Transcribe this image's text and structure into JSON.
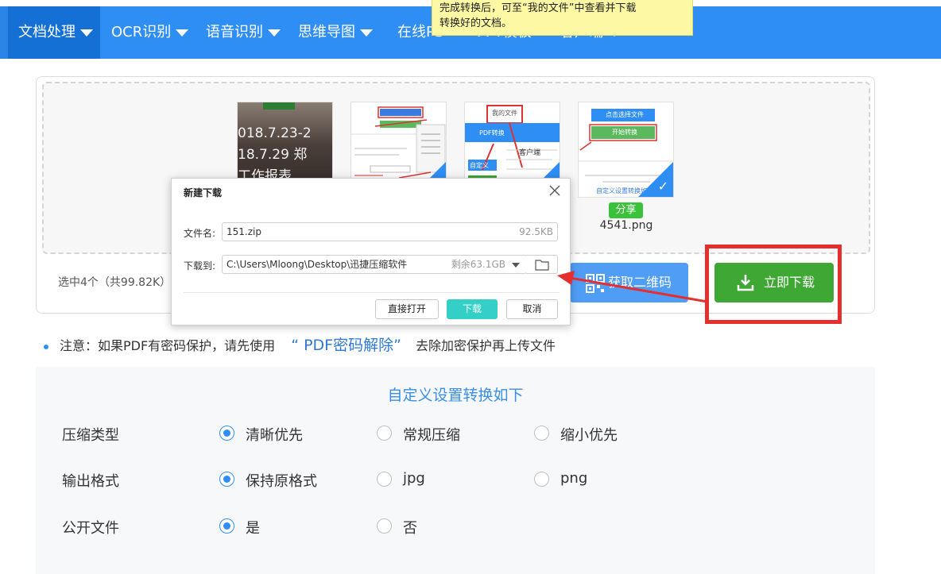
{
  "nav": {
    "items": [
      {
        "label": "文档处理",
        "dropdown": true
      },
      {
        "label": "OCR识别",
        "dropdown": true
      },
      {
        "label": "语音识别",
        "dropdown": true
      },
      {
        "label": "思维导图",
        "dropdown": true
      },
      {
        "label": "在线PS",
        "dropdown": false
      },
      {
        "label": "PPT模板",
        "dropdown": false
      },
      {
        "label": "客户端",
        "dropdown": true
      }
    ],
    "active_index": 0,
    "colors": {
      "bar": "#2f8ef4",
      "active": "#1570d6"
    }
  },
  "tooltip": {
    "line1": "完成转换后，可至“我的文件”中查看并下载",
    "line2": "转换好的文档。"
  },
  "upload": {
    "thumb1_lines": [
      "018.7.23-2",
      "18.7.29 郑",
      "工作报表"
    ],
    "thumb4": {
      "share_label": "分享",
      "file_name": "4541.png",
      "top_button": "点击选择文件",
      "mid_button": "开始转换",
      "bottom_link": "自定义设置转换如下"
    },
    "thumb3": {
      "tab_label": "我的文件",
      "blue_tab": "PDF转换",
      "customer": "客户端",
      "side": "自定义"
    },
    "selected_info": "选中4个（共99.82K）",
    "qr_button": "获取二维码",
    "download_button": "立即下载"
  },
  "dialog": {
    "title": "新建下载",
    "filename_label": "文件名:",
    "filename_value": "151.zip",
    "filename_size": "92.5KB",
    "path_label": "下载到:",
    "path_value": "C:\\Users\\Mloong\\Desktop\\迅捷压缩软件",
    "path_free": "剩余63.1GB",
    "btn_open": "直接打开",
    "btn_download": "下载",
    "btn_cancel": "取消"
  },
  "notice": {
    "prefix": "注意：如果PDF有密码保护，请先使用",
    "link": "“ PDF密码解除”",
    "suffix": "去除加密保护再上传文件"
  },
  "settings": {
    "title": "自定义设置转换如下",
    "rows": [
      {
        "label": "压缩类型",
        "options": [
          "清晰优先",
          "常规压缩",
          "缩小优先"
        ],
        "selected": 0
      },
      {
        "label": "输出格式",
        "options": [
          "保持原格式",
          "jpg",
          "png"
        ],
        "selected": 0
      },
      {
        "label": "公开文件",
        "options": [
          "是",
          "否"
        ],
        "selected": 0
      }
    ]
  },
  "accent_colors": {
    "blue": "#2f8ef4",
    "green": "#3fa834",
    "red_highlight": "#e52e2e",
    "teal": "#34d0c8"
  }
}
